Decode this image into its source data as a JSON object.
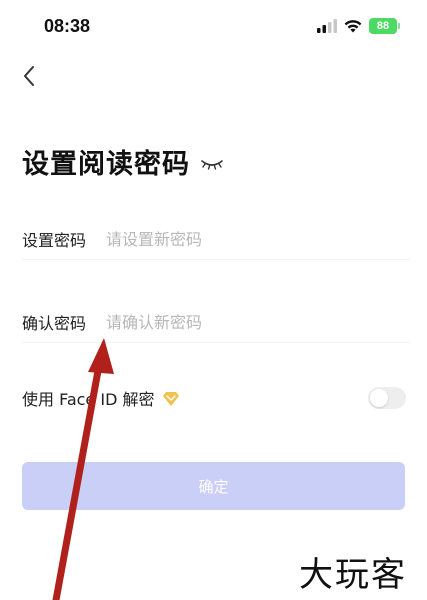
{
  "status_bar": {
    "time": "08:38",
    "battery": "88"
  },
  "page": {
    "title": "设置阅读密码"
  },
  "form": {
    "set_password": {
      "label": "设置密码",
      "placeholder": "请设置新密码"
    },
    "confirm_password": {
      "label": "确认密码",
      "placeholder": "请确认新密码"
    },
    "face_id": {
      "label": "使用 Face ID 解密",
      "enabled": false
    },
    "confirm_button": "确定"
  },
  "watermark": "大玩客",
  "colors": {
    "button_disabled": "#c9cff6",
    "annotation_arrow": "#b0211b",
    "vip_badge": "#f2c14e",
    "battery": "#4cd964"
  },
  "icons": [
    "back-chevron-icon",
    "closed-eye-icon",
    "vip-diamond-icon",
    "signal-icon",
    "wifi-icon",
    "battery-icon"
  ]
}
